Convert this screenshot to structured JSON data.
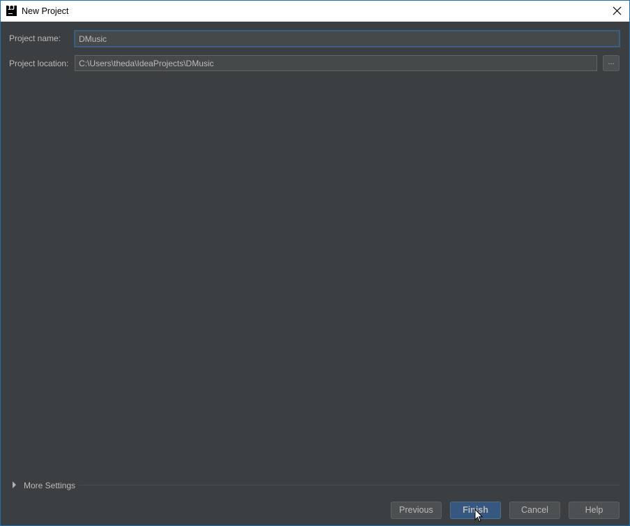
{
  "window": {
    "title": "New Project",
    "icon": "intellij-idea-icon",
    "icon_text": "IJ"
  },
  "form": {
    "project_name_label": "Project name:",
    "project_name_value": "DMusic",
    "project_location_label": "Project location:",
    "project_location_value": "C:\\Users\\theda\\IdeaProjects\\DMusic",
    "browse_label": "..."
  },
  "more_settings": {
    "label": "More Settings",
    "expanded": false
  },
  "buttons": {
    "previous": "Previous",
    "finish": "Finish",
    "cancel": "Cancel",
    "help": "Help"
  },
  "colors": {
    "background": "#3c3f41",
    "default_button": "#365880",
    "focus_border": "#3d6185"
  }
}
